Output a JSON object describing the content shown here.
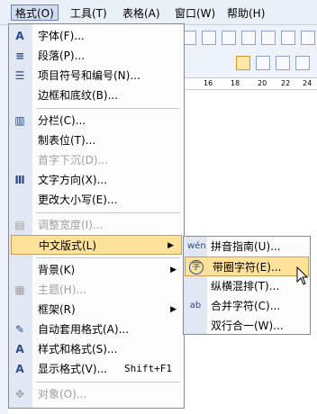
{
  "menubar": {
    "items": [
      {
        "label": "格式(O)"
      },
      {
        "label": "工具(T)"
      },
      {
        "label": "表格(A)"
      },
      {
        "label": "窗口(W)"
      },
      {
        "label": "帮助(H)"
      }
    ]
  },
  "ruler": {
    "ticks": [
      "16",
      "18",
      "20",
      "22",
      "24"
    ]
  },
  "format_menu": {
    "items": [
      {
        "label": "字体(F)...",
        "icon": "A"
      },
      {
        "label": "段落(P)...",
        "icon": "≡"
      },
      {
        "label": "项目符号和编号(N)...",
        "icon": "☰"
      },
      {
        "label": "边框和底纹(B)..."
      },
      {
        "label": "分栏(C)...",
        "icon": "▥"
      },
      {
        "label": "制表位(T)..."
      },
      {
        "label": "首字下沉(D)..."
      },
      {
        "label": "文字方向(X)...",
        "icon": "Ⅲ"
      },
      {
        "label": "更改大小写(E)..."
      },
      {
        "label": "调整宽度(I)...",
        "icon": "▤"
      },
      {
        "label": "中文版式(L)"
      },
      {
        "label": "背景(K)"
      },
      {
        "label": "主题(H)...",
        "icon": "▦"
      },
      {
        "label": "框架(R)"
      },
      {
        "label": "自动套用格式(A)...",
        "icon": "✎"
      },
      {
        "label": "样式和格式(S)...",
        "icon": "A"
      },
      {
        "label": "显示格式(V)...",
        "shortcut": "Shift+F1",
        "icon": "A"
      },
      {
        "label": "对象(O)...",
        "icon": "✥"
      }
    ]
  },
  "submenu": {
    "items": [
      {
        "label": "拼音指南(U)...",
        "icon": "wén"
      },
      {
        "label": "带圈字符(E)...",
        "icon": "字"
      },
      {
        "label": "纵横混排(T)..."
      },
      {
        "label": "合并字符(C)...",
        "icon": "ab"
      },
      {
        "label": "双行合一(W)..."
      }
    ]
  },
  "colors": {
    "highlight": "#ffe29a",
    "gutter": "#e1e7f3",
    "menubar": "#eaf0f8"
  }
}
